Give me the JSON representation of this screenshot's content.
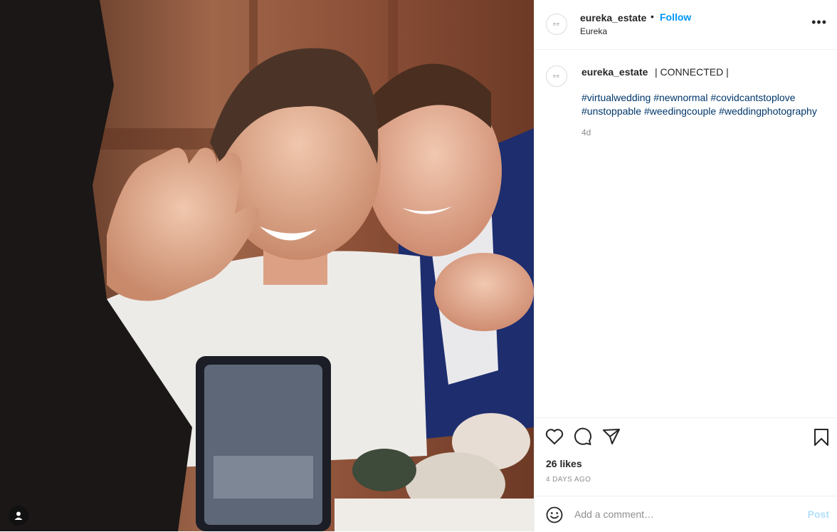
{
  "post": {
    "username": "eureka_estate",
    "follow_label": "Follow",
    "separator": "•",
    "location": "Eureka",
    "more_label": "•••",
    "avatar_text": "ee"
  },
  "caption": {
    "username": "eureka_estate",
    "text": "| CONNECTED |",
    "hashtags": [
      "#virtualwedding",
      "#newnormal",
      "#covidcantstoplove",
      "#unstoppable",
      "#weedingcouple",
      "#weddingphotography"
    ],
    "age": "4d"
  },
  "engagement": {
    "likes": "26 likes",
    "date": "4 DAYS AGO"
  },
  "comment": {
    "placeholder": "Add a comment…",
    "post_label": "Post"
  },
  "icons": {
    "like": "heart-icon",
    "comment": "comment-icon",
    "share": "paper-plane-icon",
    "save": "bookmark-icon",
    "emoji": "smiley-icon",
    "user": "user-icon"
  },
  "colors": {
    "accent": "#0095f6",
    "hashtag": "#00376b",
    "muted": "#8e8e8e",
    "post_disabled": "#b2dffc"
  }
}
